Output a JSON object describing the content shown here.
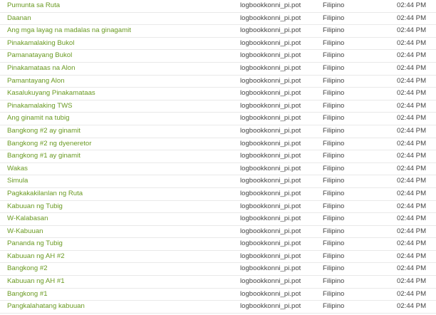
{
  "colors": {
    "link": "#6a9a22",
    "text": "#444444",
    "divider": "#e9e9e9"
  },
  "rows": [
    {
      "string": "Pumunta sa Ruta",
      "file": "logbookkonni_pi.pot",
      "language": "Filipino",
      "time": "02:44 PM"
    },
    {
      "string": "Daanan",
      "file": "logbookkonni_pi.pot",
      "language": "Filipino",
      "time": "02:44 PM"
    },
    {
      "string": "Ang mga layag na madalas na ginagamit",
      "file": "logbookkonni_pi.pot",
      "language": "Filipino",
      "time": "02:44 PM"
    },
    {
      "string": "Pinakamalaking Bukol",
      "file": "logbookkonni_pi.pot",
      "language": "Filipino",
      "time": "02:44 PM"
    },
    {
      "string": "Pamanatayang Bukol",
      "file": "logbookkonni_pi.pot",
      "language": "Filipino",
      "time": "02:44 PM"
    },
    {
      "string": "Pinakamataas na Alon",
      "file": "logbookkonni_pi.pot",
      "language": "Filipino",
      "time": "02:44 PM"
    },
    {
      "string": "Pamantayang Alon",
      "file": "logbookkonni_pi.pot",
      "language": "Filipino",
      "time": "02:44 PM"
    },
    {
      "string": "Kasalukuyang Pinakamataas",
      "file": "logbookkonni_pi.pot",
      "language": "Filipino",
      "time": "02:44 PM"
    },
    {
      "string": "Pinakamalaking TWS",
      "file": "logbookkonni_pi.pot",
      "language": "Filipino",
      "time": "02:44 PM"
    },
    {
      "string": "Ang ginamit na tubig",
      "file": "logbookkonni_pi.pot",
      "language": "Filipino",
      "time": "02:44 PM"
    },
    {
      "string": "Bangkong #2 ay ginamit",
      "file": "logbookkonni_pi.pot",
      "language": "Filipino",
      "time": "02:44 PM"
    },
    {
      "string": "Bangkong #2 ng dyeneretor",
      "file": "logbookkonni_pi.pot",
      "language": "Filipino",
      "time": "02:44 PM"
    },
    {
      "string": "Bangkong #1 ay ginamit",
      "file": "logbookkonni_pi.pot",
      "language": "Filipino",
      "time": "02:44 PM"
    },
    {
      "string": "Wakas",
      "file": "logbookkonni_pi.pot",
      "language": "Filipino",
      "time": "02:44 PM"
    },
    {
      "string": "Simula",
      "file": "logbookkonni_pi.pot",
      "language": "Filipino",
      "time": "02:44 PM"
    },
    {
      "string": "Pagkakakilanlan ng Ruta",
      "file": "logbookkonni_pi.pot",
      "language": "Filipino",
      "time": "02:44 PM"
    },
    {
      "string": "Kabuuan ng Tubig",
      "file": "logbookkonni_pi.pot",
      "language": "Filipino",
      "time": "02:44 PM"
    },
    {
      "string": "W-Kalabasan",
      "file": "logbookkonni_pi.pot",
      "language": "Filipino",
      "time": "02:44 PM"
    },
    {
      "string": "W-Kabuuan",
      "file": "logbookkonni_pi.pot",
      "language": "Filipino",
      "time": "02:44 PM"
    },
    {
      "string": "Pananda ng Tubig",
      "file": "logbookkonni_pi.pot",
      "language": "Filipino",
      "time": "02:44 PM"
    },
    {
      "string": "Kabuuan ng AH #2",
      "file": "logbookkonni_pi.pot",
      "language": "Filipino",
      "time": "02:44 PM"
    },
    {
      "string": "Bangkong #2",
      "file": "logbookkonni_pi.pot",
      "language": "Filipino",
      "time": "02:44 PM"
    },
    {
      "string": "Kabuuan ng AH #1",
      "file": "logbookkonni_pi.pot",
      "language": "Filipino",
      "time": "02:44 PM"
    },
    {
      "string": "Bangkong #1",
      "file": "logbookkonni_pi.pot",
      "language": "Filipino",
      "time": "02:44 PM"
    },
    {
      "string": "Pangkalahatang kabuuan",
      "file": "logbookkonni_pi.pot",
      "language": "Filipino",
      "time": "02:44 PM"
    }
  ]
}
